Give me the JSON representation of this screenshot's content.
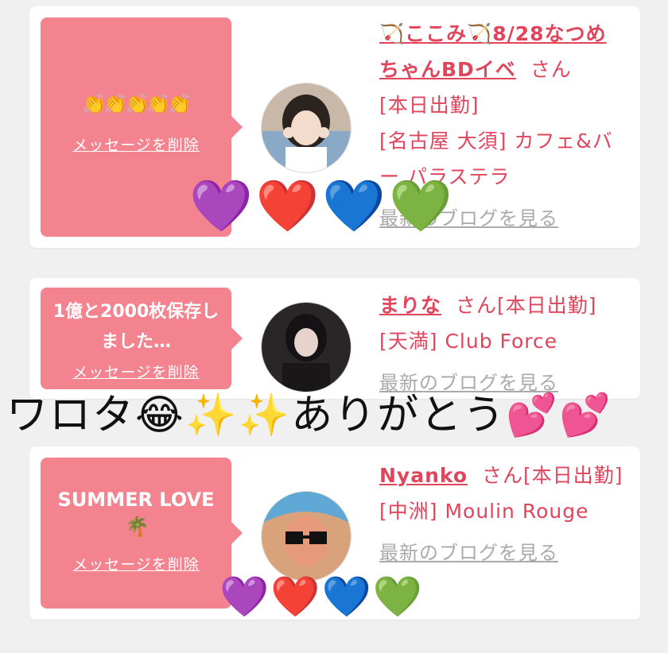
{
  "cards": [
    {
      "message_emoji": "👏👏👏👏👏",
      "delete_label": "メッセージを削除",
      "name": "🏹ここみ🏹8/28なつめちゃんBDイベ",
      "honorific": "さん",
      "status": "[本日出勤]",
      "shop": "[名古屋 大須] カフェ&バー パラステラ",
      "blog_label": "最新のブログを見る"
    },
    {
      "message": "1億と2000枚保存しました…",
      "delete_label": "メッセージを削除",
      "name": "まりな",
      "honorific": "さん[本日出勤]",
      "shop": "[天満] Club Force",
      "blog_label": "最新のブログを見る"
    },
    {
      "message": "SUMMER LOVE",
      "message_emoji": "🌴",
      "delete_label": "メッセージを削除",
      "name": "Nyanko",
      "honorific": "さん[本日出勤]",
      "shop": "[中洲] Moulin Rouge",
      "blog_label": "最新のブログを見る"
    }
  ],
  "overlay": {
    "caption": "ワロタ😂✨✨ありがとう💕💕",
    "hearts_top": "💜❤️💙💚",
    "hearts_bottom": "💜❤️💙💚"
  },
  "colors": {
    "accent": "#e0455c",
    "bubble": "#f2838f",
    "background": "#f0f0f0"
  }
}
